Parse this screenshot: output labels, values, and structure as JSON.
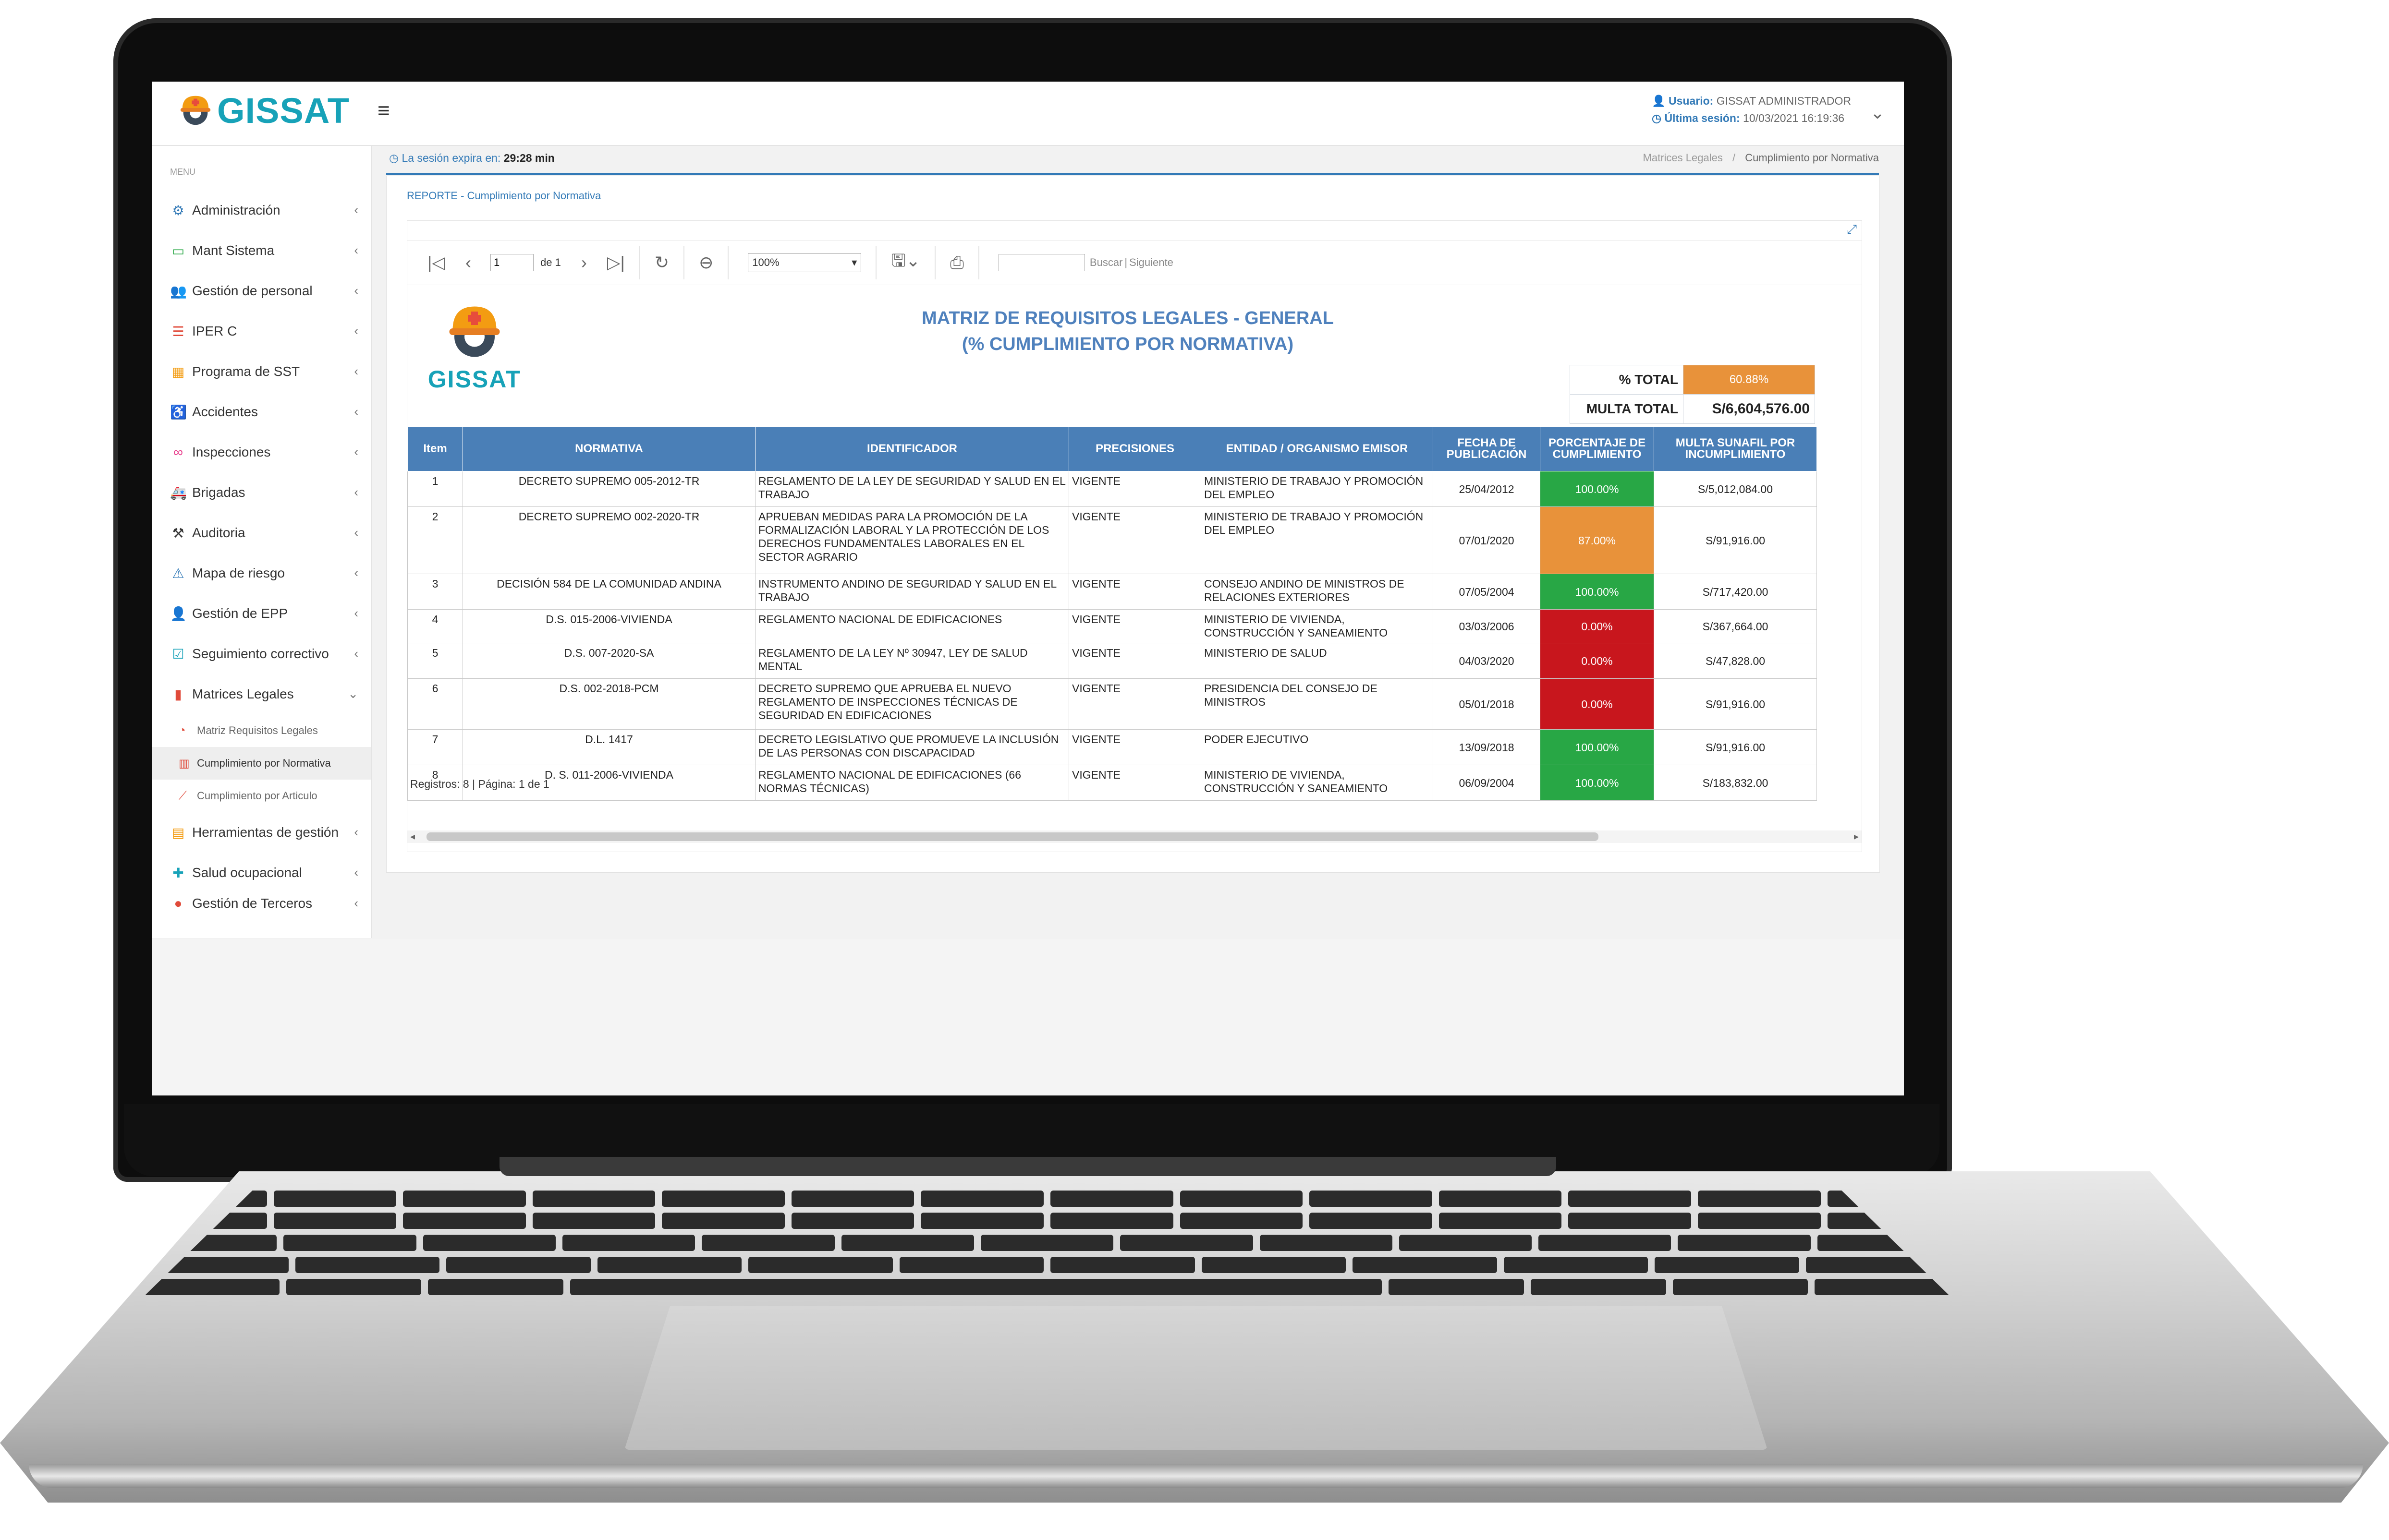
{
  "header": {
    "brand": "GISSAT",
    "menu_toggle": "≡",
    "user_label": "Usuario:",
    "user_value": "GISSAT ADMINISTRADOR",
    "last_session_label": "Última sesión:",
    "last_session_value": "10/03/2021 16:19:36"
  },
  "sidebar": {
    "caption": "MENU",
    "items": [
      {
        "label": "Administración",
        "icon": "gear-icon"
      },
      {
        "label": "Mant Sistema",
        "icon": "monitor-icon"
      },
      {
        "label": "Gestión de personal",
        "icon": "users-icon"
      },
      {
        "label": "IPER C",
        "icon": "list-icon"
      },
      {
        "label": "Programa de SST",
        "icon": "calendar-icon"
      },
      {
        "label": "Accidentes",
        "icon": "wheelchair-icon"
      },
      {
        "label": "Inspecciones",
        "icon": "binoculars-icon"
      },
      {
        "label": "Brigadas",
        "icon": "ambulance-icon"
      },
      {
        "label": "Auditoria",
        "icon": "gavel-icon"
      },
      {
        "label": "Mapa de riesgo",
        "icon": "warning-icon"
      },
      {
        "label": "Gestión de EPP",
        "icon": "worker-icon"
      },
      {
        "label": "Seguimiento correctivo",
        "icon": "check-square-icon"
      },
      {
        "label": "Matrices Legales",
        "icon": "book-icon"
      }
    ],
    "subitems": [
      {
        "label": "Matriz Requisitos Legales"
      },
      {
        "label": "Cumplimiento por Normativa"
      },
      {
        "label": "Cumplimiento por Articulo"
      }
    ],
    "items_after": [
      {
        "label": "Herramientas de gestión",
        "icon": "clipboard-icon"
      },
      {
        "label": "Salud ocupacional",
        "icon": "medkit-icon"
      },
      {
        "label": "Gestión de Terceros",
        "icon": "user-icon"
      }
    ]
  },
  "session": {
    "label": "La sesión expira en:",
    "time": "29:28 min"
  },
  "breadcrumb": {
    "parent": "Matrices Legales",
    "separator": "/",
    "current": "Cumplimiento por Normativa"
  },
  "panel_title": "REPORTE - Cumplimiento por Normativa",
  "toolbar": {
    "page": "1",
    "of": "de 1",
    "zoom": "100%",
    "find": "Buscar",
    "next": "Siguiente"
  },
  "report": {
    "logo_text": "GISSAT",
    "title_line1": "MATRIZ DE REQUISITOS LEGALES - GENERAL",
    "title_line2": "(% CUMPLIMIENTO POR NORMATIVA)",
    "total_label": "% TOTAL",
    "total_value": "60.88%",
    "multa_label": "MULTA TOTAL",
    "multa_value": "S/6,604,576.00",
    "columns": [
      "Item",
      "NORMATIVA",
      "IDENTIFICADOR",
      "PRECISIONES",
      "ENTIDAD / ORGANISMO EMISOR",
      "FECHA DE PUBLICACIÓN",
      "PORCENTAJE DE CUMPLIMIENTO",
      "MULTA SUNAFIL POR INCUMPLIMIENTO"
    ],
    "rows": [
      {
        "item": "1",
        "normativa": "DECRETO SUPREMO 005-2012-TR",
        "identificador": "REGLAMENTO DE LA LEY DE SEGURIDAD Y SALUD EN EL TRABAJO",
        "precisiones": "VIGENTE",
        "entidad": "MINISTERIO DE TRABAJO Y PROMOCIÓN DEL EMPLEO",
        "fecha": "25/04/2012",
        "porcentaje": "100.00%",
        "multa": "S/5,012,084.00"
      },
      {
        "item": "2",
        "normativa": "DECRETO SUPREMO 002-2020-TR",
        "identificador": "APRUEBAN MEDIDAS PARA LA PROMOCIÓN DE LA FORMALIZACIÓN LABORAL Y LA PROTECCIÓN DE LOS DERECHOS FUNDAMENTALES LABORALES EN EL SECTOR AGRARIO",
        "precisiones": "VIGENTE",
        "entidad": "MINISTERIO DE TRABAJO Y PROMOCIÓN DEL EMPLEO",
        "fecha": "07/01/2020",
        "porcentaje": "87.00%",
        "multa": "S/91,916.00"
      },
      {
        "item": "3",
        "normativa": "DECISIÓN 584 DE LA COMUNIDAD ANDINA",
        "identificador": "INSTRUMENTO ANDINO DE SEGURIDAD Y SALUD EN EL TRABAJO",
        "precisiones": "VIGENTE",
        "entidad": "CONSEJO ANDINO DE MINISTROS DE RELACIONES EXTERIORES",
        "fecha": "07/05/2004",
        "porcentaje": "100.00%",
        "multa": "S/717,420.00"
      },
      {
        "item": "4",
        "normativa": "D.S. 015-2006-VIVIENDA",
        "identificador": "REGLAMENTO NACIONAL DE EDIFICACIONES",
        "precisiones": "VIGENTE",
        "entidad": "MINISTERIO DE VIVIENDA, CONSTRUCCIÓN Y SANEAMIENTO",
        "fecha": "03/03/2006",
        "porcentaje": "0.00%",
        "multa": "S/367,664.00"
      },
      {
        "item": "5",
        "normativa": "D.S. 007-2020-SA",
        "identificador": "REGLAMENTO DE LA LEY Nº 30947, LEY DE SALUD MENTAL",
        "precisiones": "VIGENTE",
        "entidad": "MINISTERIO DE SALUD",
        "fecha": "04/03/2020",
        "porcentaje": "0.00%",
        "multa": "S/47,828.00"
      },
      {
        "item": "6",
        "normativa": "D.S. 002-2018-PCM",
        "identificador": "DECRETO SUPREMO QUE APRUEBA EL NUEVO REGLAMENTO DE INSPECCIONES TÉCNICAS DE SEGURIDAD EN EDIFICACIONES",
        "precisiones": "VIGENTE",
        "entidad": "PRESIDENCIA DEL CONSEJO DE MINISTROS",
        "fecha": "05/01/2018",
        "porcentaje": "0.00%",
        "multa": "S/91,916.00"
      },
      {
        "item": "7",
        "normativa": "D.L. 1417",
        "identificador": "DECRETO LEGISLATIVO QUE PROMUEVE LA INCLUSIÓN DE LAS PERSONAS CON DISCAPACIDAD",
        "precisiones": "VIGENTE",
        "entidad": "PODER EJECUTIVO",
        "fecha": "13/09/2018",
        "porcentaje": "100.00%",
        "multa": "S/91,916.00"
      },
      {
        "item": "8",
        "normativa": "D. S. 011-2006-VIVIENDA",
        "identificador": "REGLAMENTO NACIONAL DE EDIFICACIONES (66 NORMAS TÉCNICAS)",
        "precisiones": "VIGENTE",
        "entidad": "MINISTERIO DE VIVIENDA, CONSTRUCCIÓN Y SANEAMIENTO",
        "fecha": "06/09/2004",
        "porcentaje": "100.00%",
        "multa": "S/183,832.00"
      }
    ],
    "footer": "Registros: 8 | Página: 1 de 1"
  },
  "colors": {
    "brand": "#17a2b8",
    "header_blue": "#4a7fb7",
    "green": "#28a745",
    "orange": "#e8923a",
    "red": "#c8161d"
  }
}
